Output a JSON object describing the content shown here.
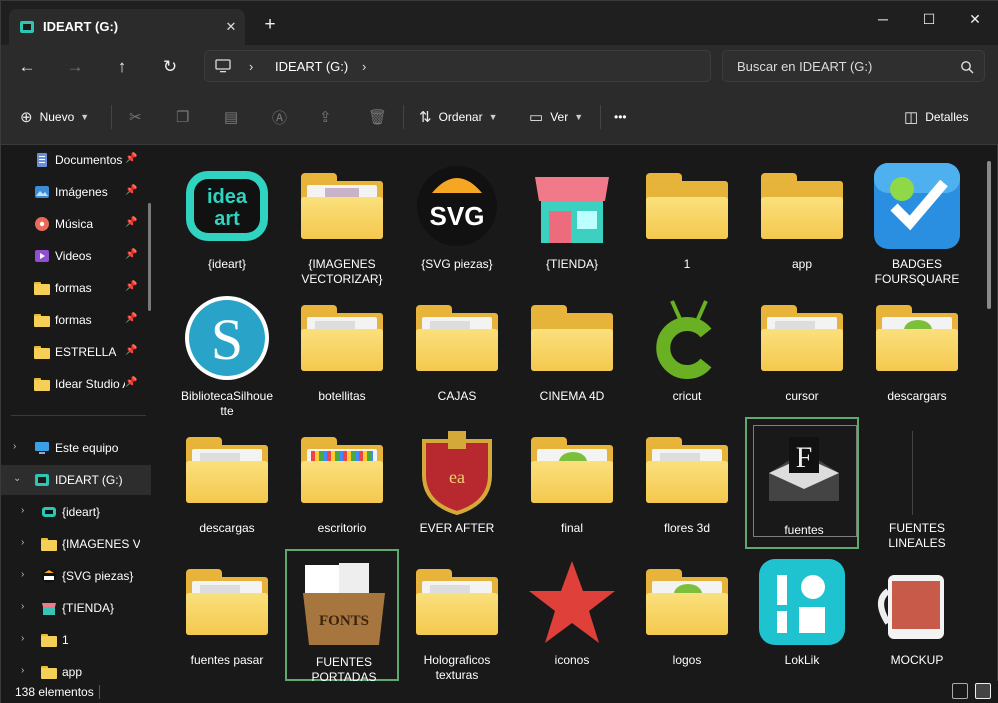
{
  "window": {
    "tab_title": "IDEART (G:)",
    "new_tab": "+",
    "minimize": "─",
    "maximize": "☐",
    "close": "✕",
    "tab_close": "✕"
  },
  "address": {
    "path": "IDEART (G:)",
    "sep": "›",
    "search_placeholder": "Buscar en IDEART (G:)"
  },
  "nav": {
    "back": "←",
    "forward": "→",
    "up": "↑",
    "refresh": "↻"
  },
  "toolbar": {
    "new_label": "Nuevo",
    "sort_label": "Ordenar",
    "view_label": "Ver",
    "more": "•••",
    "details_label": "Detalles"
  },
  "sidebar": {
    "quick": [
      {
        "label": "Documentos",
        "icon": "document-icon"
      },
      {
        "label": "Imágenes",
        "icon": "image-icon"
      },
      {
        "label": "Música",
        "icon": "music-icon"
      },
      {
        "label": "Videos",
        "icon": "video-icon"
      },
      {
        "label": "formas",
        "icon": "folder-icon"
      },
      {
        "label": "formas",
        "icon": "folder-icon"
      },
      {
        "label": "ESTRELLA",
        "icon": "folder-icon"
      },
      {
        "label": "Idear Studio A",
        "icon": "folder-icon"
      }
    ],
    "tree": [
      {
        "label": "Este equipo",
        "icon": "pc-icon",
        "expand": "›"
      },
      {
        "label": "IDEART (G:)",
        "icon": "drive-icon",
        "expand": "⌄"
      },
      {
        "label": "{ideart}",
        "icon": "ideart-icon",
        "expand": "›"
      },
      {
        "label": "{IMAGENES VE",
        "icon": "folder-icon",
        "expand": "›"
      },
      {
        "label": "{SVG piezas}",
        "icon": "svg-icon",
        "expand": "›"
      },
      {
        "label": "{TIENDA}",
        "icon": "shop-icon",
        "expand": "›"
      },
      {
        "label": "1",
        "icon": "folder-icon",
        "expand": "›"
      },
      {
        "label": "app",
        "icon": "folder-icon",
        "expand": "›"
      }
    ]
  },
  "items": [
    {
      "l1": "{ideart}",
      "l2": "",
      "kind": "ideart"
    },
    {
      "l1": "{IMAGENES",
      "l2": "VECTORIZAR}",
      "kind": "folder-photo"
    },
    {
      "l1": "{SVG piezas}",
      "l2": "",
      "kind": "svg"
    },
    {
      "l1": "{TIENDA}",
      "l2": "",
      "kind": "shop"
    },
    {
      "l1": "1",
      "l2": "",
      "kind": "folder"
    },
    {
      "l1": "app",
      "l2": "",
      "kind": "folder"
    },
    {
      "l1": "BADGES",
      "l2": "FOURSQUARE",
      "kind": "foursquare"
    },
    {
      "l1": "BibliotecaSilhoue",
      "l2": "tte",
      "kind": "silhouette"
    },
    {
      "l1": "botellitas",
      "l2": "",
      "kind": "folder-paper"
    },
    {
      "l1": "CAJAS",
      "l2": "",
      "kind": "folder-paper"
    },
    {
      "l1": "CINEMA 4D",
      "l2": "",
      "kind": "folder"
    },
    {
      "l1": "cricut",
      "l2": "",
      "kind": "cricut"
    },
    {
      "l1": "cursor",
      "l2": "",
      "kind": "folder-paper"
    },
    {
      "l1": "descargars",
      "l2": "",
      "kind": "folder-green"
    },
    {
      "l1": "descargas",
      "l2": "",
      "kind": "folder-paper"
    },
    {
      "l1": "escritorio",
      "l2": "",
      "kind": "folder-dots"
    },
    {
      "l1": "EVER AFTER",
      "l2": "",
      "kind": "crest"
    },
    {
      "l1": "final",
      "l2": "",
      "kind": "folder-green"
    },
    {
      "l1": "flores 3d",
      "l2": "",
      "kind": "folder-paper"
    },
    {
      "l1": "fuentes",
      "l2": "",
      "kind": "fontapp"
    },
    {
      "l1": "FUENTES",
      "l2": "LINEALES",
      "kind": "blank"
    },
    {
      "l1": "fuentes pasar",
      "l2": "",
      "kind": "folder-paper"
    },
    {
      "l1": "FUENTES",
      "l2": "PORTADAS",
      "kind": "fontbox"
    },
    {
      "l1": "Holograficos",
      "l2": "texturas",
      "kind": "folder-paper"
    },
    {
      "l1": "iconos",
      "l2": "",
      "kind": "star"
    },
    {
      "l1": "logos",
      "l2": "",
      "kind": "folder-green"
    },
    {
      "l1": "LokLik",
      "l2": "",
      "kind": "loklik"
    },
    {
      "l1": "MOCKUP",
      "l2": "",
      "kind": "mug"
    }
  ],
  "status": {
    "count": "138 elementos"
  },
  "colors": {
    "accent_folder": "#f6cf57",
    "selection": "#5fa96e"
  }
}
